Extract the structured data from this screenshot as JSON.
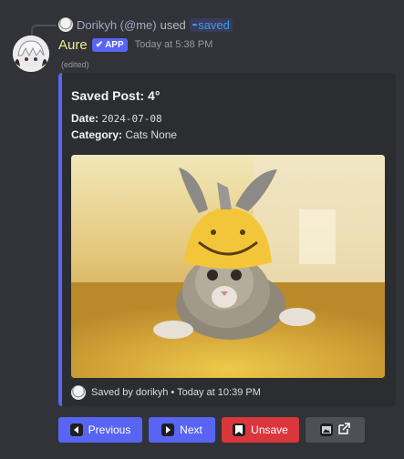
{
  "reply": {
    "user": "Dorikyh (@me)",
    "used_text": "used",
    "command": "saved"
  },
  "message": {
    "author": "Aure",
    "badge": "APP",
    "timestamp": "Today at 5:38 PM",
    "edited": "(edited)"
  },
  "embed": {
    "accent_color": "#5865f2",
    "title": "Saved Post: 4°",
    "date_label": "Date:",
    "date_value": "2024-07-08",
    "category_label": "Category:",
    "category_value": "Cats None",
    "footer": "Saved by dorikyh • Today at 10:39 PM"
  },
  "buttons": {
    "previous": "Previous",
    "next": "Next",
    "unsave": "Unsave"
  },
  "icons": {
    "previous": "triangle-left-icon",
    "next": "triangle-right-icon",
    "unsave": "bookmark-icon",
    "image": "image-icon",
    "external": "external-link-icon"
  }
}
